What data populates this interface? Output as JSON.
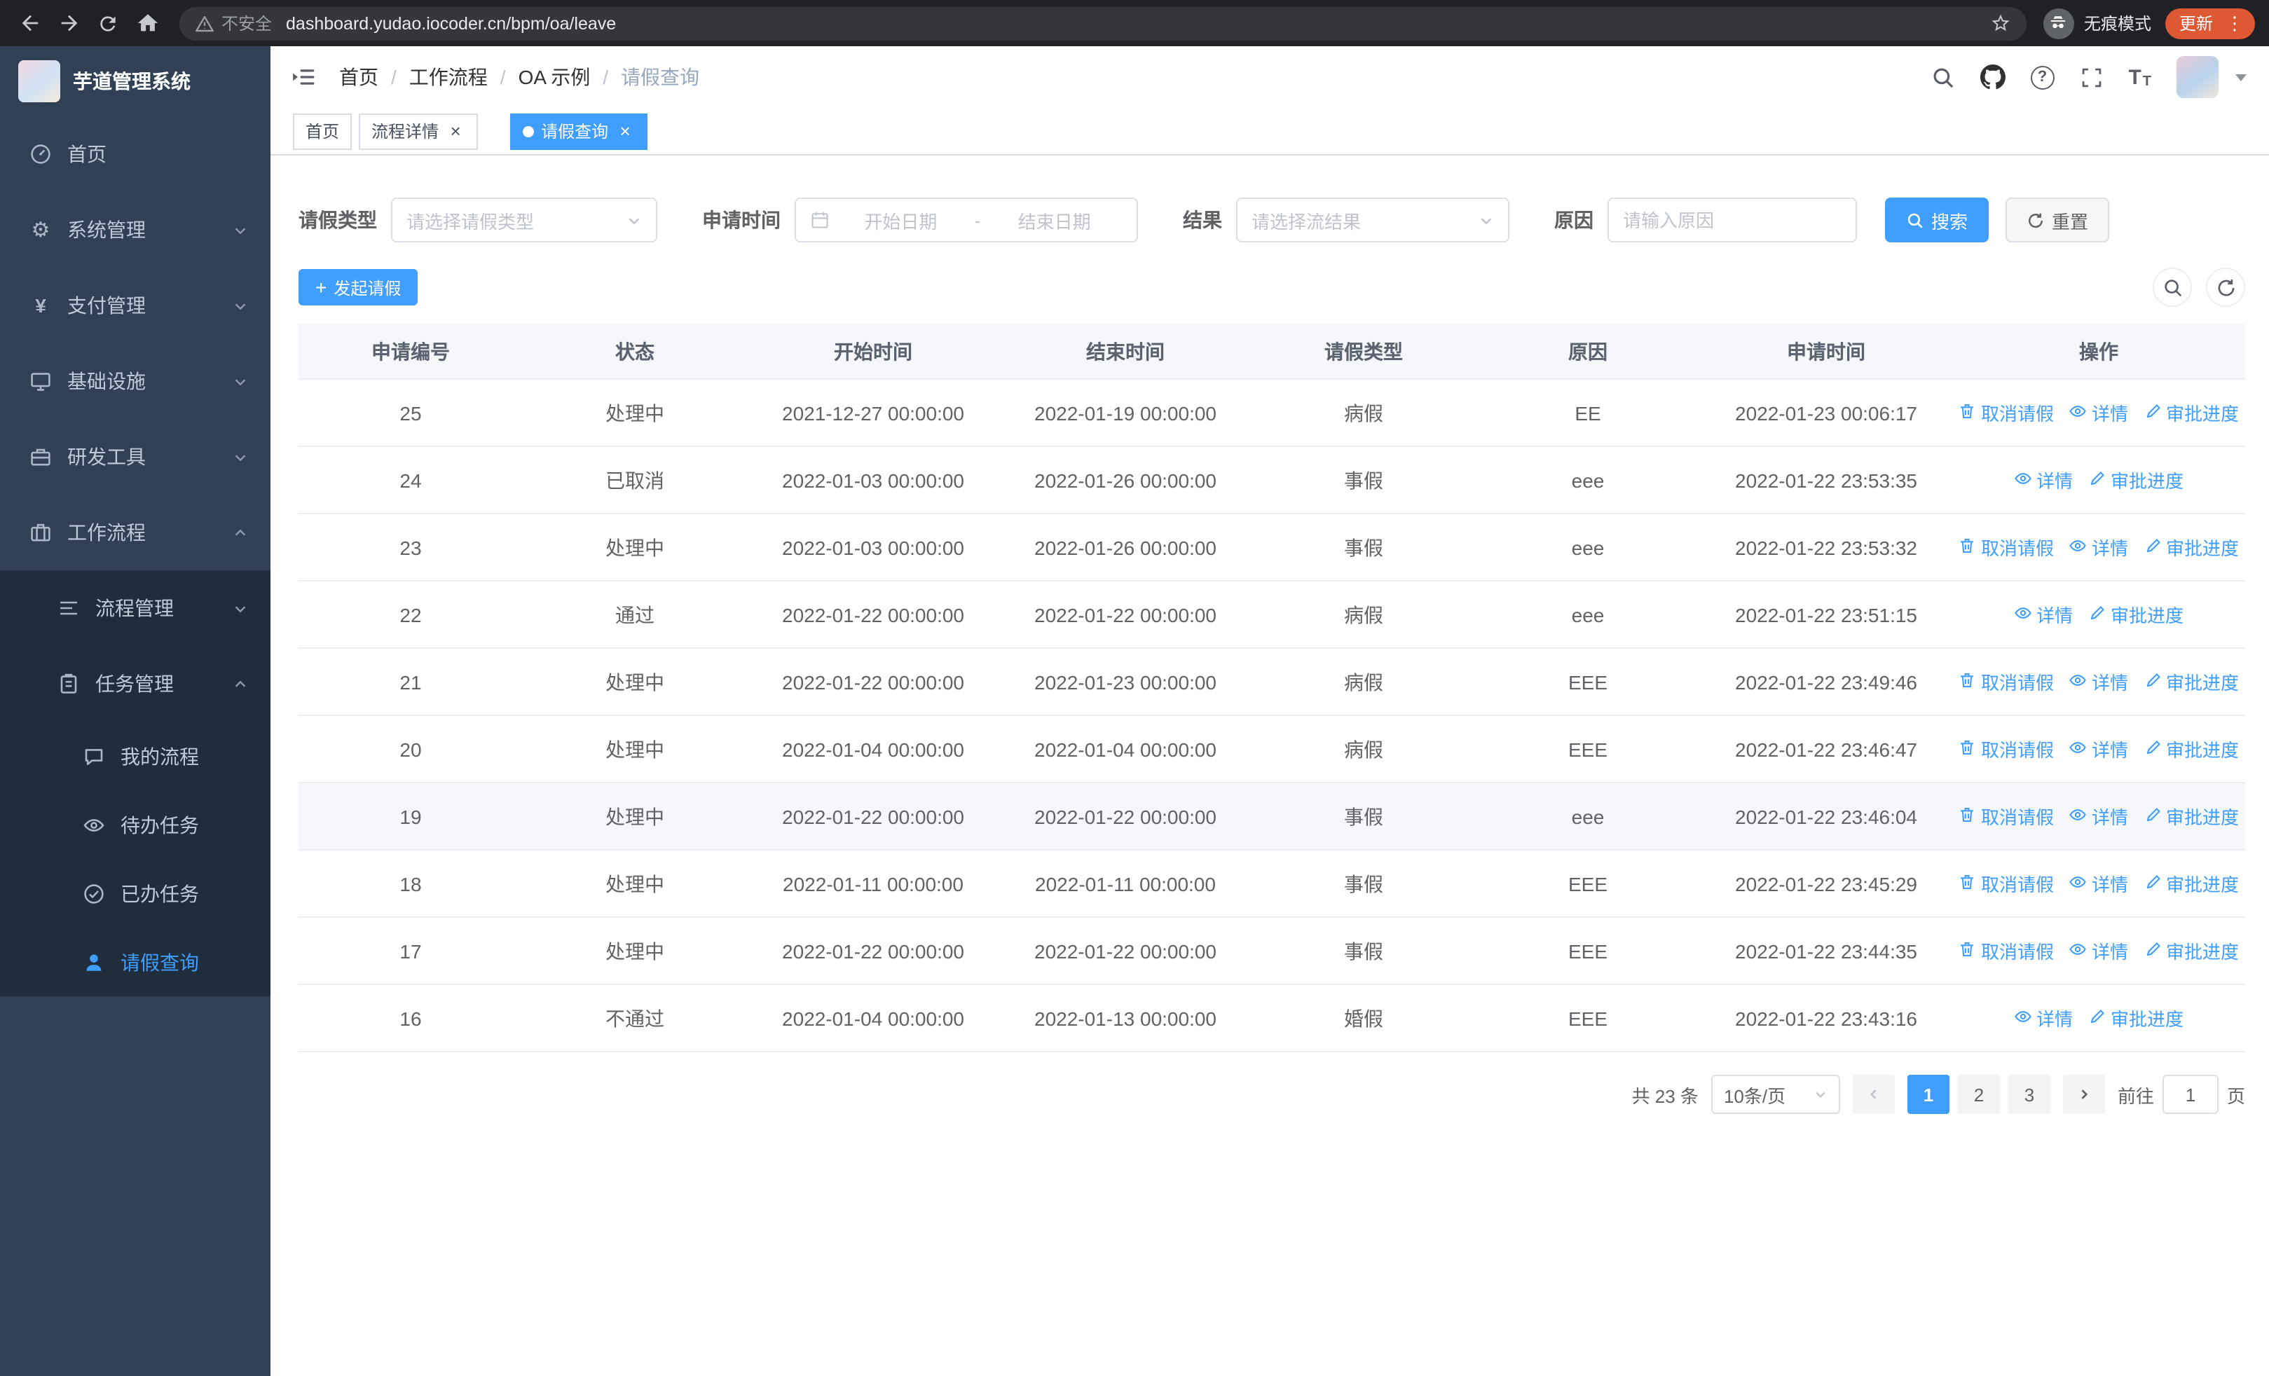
{
  "theme": {
    "primary": "#409eff",
    "sidebar_bg": "#304156",
    "submenu_bg": "#1f2d3d"
  },
  "browser": {
    "not_secure_label": "不安全",
    "url": "dashboard.yudao.iocoder.cn/bpm/oa/leave",
    "incognito_label": "无痕模式",
    "update_label": "更新"
  },
  "sidebar": {
    "app_title": "芋道管理系统",
    "menu": [
      {
        "label": "首页",
        "icon": "dashboard-icon"
      },
      {
        "label": "系统管理",
        "icon": "gear-icon"
      },
      {
        "label": "支付管理",
        "icon": "yen-icon"
      },
      {
        "label": "基础设施",
        "icon": "monitor-icon"
      },
      {
        "label": "研发工具",
        "icon": "toolbox-icon"
      },
      {
        "label": "工作流程",
        "icon": "briefcase-icon"
      }
    ],
    "workflow_children": [
      {
        "label": "流程管理",
        "icon": "list-icon"
      },
      {
        "label": "任务管理",
        "icon": "clipboard-icon"
      }
    ],
    "task_children": [
      {
        "label": "我的流程",
        "icon": "chat-icon"
      },
      {
        "label": "待办任务",
        "icon": "eye-icon"
      },
      {
        "label": "已办任务",
        "icon": "check-circle-icon"
      },
      {
        "label": "请假查询",
        "icon": "person-icon",
        "active": true
      }
    ]
  },
  "header": {
    "breadcrumb": [
      "首页",
      "工作流程",
      "OA 示例",
      "请假查询"
    ],
    "separator": "/"
  },
  "tabs": [
    {
      "label": "首页"
    },
    {
      "label": "流程详情",
      "closable": true
    },
    {
      "label": "请假查询",
      "closable": true,
      "active": true
    }
  ],
  "filters": {
    "leave_type_label": "请假类型",
    "leave_type_placeholder": "请选择请假类型",
    "apply_time_label": "申请时间",
    "start_placeholder": "开始日期",
    "range_separator": "-",
    "end_placeholder": "结束日期",
    "result_label": "结果",
    "result_placeholder": "请选择流结果",
    "reason_label": "原因",
    "reason_placeholder": "请输入原因",
    "search_label": "搜索",
    "reset_label": "重置"
  },
  "toolbar": {
    "create_label": "发起请假"
  },
  "table": {
    "columns": [
      "申请编号",
      "状态",
      "开始时间",
      "结束时间",
      "请假类型",
      "原因",
      "申请时间",
      "操作"
    ],
    "column_keys": [
      "id",
      "status",
      "start",
      "end",
      "type",
      "reason",
      "applied"
    ],
    "action_labels": {
      "cancel": "取消请假",
      "detail": "详情",
      "progress": "审批进度"
    },
    "action_icons": {
      "cancel": "delete-icon",
      "detail": "view-icon",
      "progress": "edit-icon"
    },
    "rows": [
      {
        "id": "25",
        "status": "处理中",
        "start": "2021-12-27 00:00:00",
        "end": "2022-01-19 00:00:00",
        "type": "病假",
        "reason": "EE",
        "applied": "2022-01-23 00:06:17",
        "actions": [
          "cancel",
          "detail",
          "progress"
        ]
      },
      {
        "id": "24",
        "status": "已取消",
        "start": "2022-01-03 00:00:00",
        "end": "2022-01-26 00:00:00",
        "type": "事假",
        "reason": "eee",
        "applied": "2022-01-22 23:53:35",
        "actions": [
          "detail",
          "progress"
        ]
      },
      {
        "id": "23",
        "status": "处理中",
        "start": "2022-01-03 00:00:00",
        "end": "2022-01-26 00:00:00",
        "type": "事假",
        "reason": "eee",
        "applied": "2022-01-22 23:53:32",
        "actions": [
          "cancel",
          "detail",
          "progress"
        ]
      },
      {
        "id": "22",
        "status": "通过",
        "start": "2022-01-22 00:00:00",
        "end": "2022-01-22 00:00:00",
        "type": "病假",
        "reason": "eee",
        "applied": "2022-01-22 23:51:15",
        "actions": [
          "detail",
          "progress"
        ]
      },
      {
        "id": "21",
        "status": "处理中",
        "start": "2022-01-22 00:00:00",
        "end": "2022-01-23 00:00:00",
        "type": "病假",
        "reason": "EEE",
        "applied": "2022-01-22 23:49:46",
        "actions": [
          "cancel",
          "detail",
          "progress"
        ]
      },
      {
        "id": "20",
        "status": "处理中",
        "start": "2022-01-04 00:00:00",
        "end": "2022-01-04 00:00:00",
        "type": "病假",
        "reason": "EEE",
        "applied": "2022-01-22 23:46:47",
        "actions": [
          "cancel",
          "detail",
          "progress"
        ]
      },
      {
        "id": "19",
        "status": "处理中",
        "start": "2022-01-22 00:00:00",
        "end": "2022-01-22 00:00:00",
        "type": "事假",
        "reason": "eee",
        "applied": "2022-01-22 23:46:04",
        "actions": [
          "cancel",
          "detail",
          "progress"
        ],
        "highlighted": true
      },
      {
        "id": "18",
        "status": "处理中",
        "start": "2022-01-11 00:00:00",
        "end": "2022-01-11 00:00:00",
        "type": "事假",
        "reason": "EEE",
        "applied": "2022-01-22 23:45:29",
        "actions": [
          "cancel",
          "detail",
          "progress"
        ]
      },
      {
        "id": "17",
        "status": "处理中",
        "start": "2022-01-22 00:00:00",
        "end": "2022-01-22 00:00:00",
        "type": "事假",
        "reason": "EEE",
        "applied": "2022-01-22 23:44:35",
        "actions": [
          "cancel",
          "detail",
          "progress"
        ]
      },
      {
        "id": "16",
        "status": "不通过",
        "start": "2022-01-04 00:00:00",
        "end": "2022-01-13 00:00:00",
        "type": "婚假",
        "reason": "EEE",
        "applied": "2022-01-22 23:43:16",
        "actions": [
          "detail",
          "progress"
        ]
      }
    ]
  },
  "pagination": {
    "total_text": "共 23 条",
    "page_size_label": "10条/页",
    "pages": [
      {
        "label": "1",
        "active": true
      },
      {
        "label": "2"
      },
      {
        "label": "3"
      }
    ],
    "goto_label": "前往",
    "goto_value": "1",
    "page_unit_label": "页"
  }
}
